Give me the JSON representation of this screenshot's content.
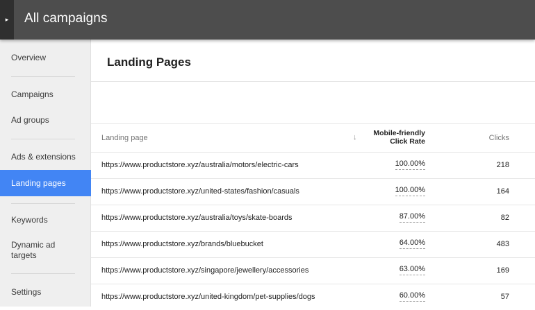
{
  "header": {
    "title": "All campaigns",
    "expand_icon": "▸"
  },
  "sidebar": {
    "items": [
      {
        "label": "Overview"
      },
      {
        "label": "Campaigns"
      },
      {
        "label": "Ad groups"
      },
      {
        "label": "Ads & extensions"
      },
      {
        "label": "Landing pages",
        "active": true
      },
      {
        "label": "Keywords"
      },
      {
        "label": "Dynamic ad targets"
      },
      {
        "label": "Settings"
      }
    ],
    "active_color": "#4285f4"
  },
  "main": {
    "title": "Landing Pages",
    "table": {
      "headers": {
        "landing_page": "Landing page",
        "sort_icon": "↓",
        "rate_line1": "Mobile-friendly",
        "rate_line2": "Click Rate",
        "clicks": "Clicks"
      },
      "rows": [
        {
          "url": "https://www.productstore.xyz/australia/motors/electric-cars",
          "rate": "100.00%",
          "clicks": "218"
        },
        {
          "url": "https://www.productstore.xyz/united-states/fashion/casuals",
          "rate": "100.00%",
          "clicks": "164"
        },
        {
          "url": "https://www.productstore.xyz/australia/toys/skate-boards",
          "rate": "87.00%",
          "clicks": "82"
        },
        {
          "url": "https://www.productstore.xyz/brands/bluebucket",
          "rate": "64.00%",
          "clicks": "483"
        },
        {
          "url": "https://www.productstore.xyz/singapore/jewellery/accessories",
          "rate": "63.00%",
          "clicks": "169"
        },
        {
          "url": "https://www.productstore.xyz/united-kingdom/pet-supplies/dogs",
          "rate": "60.00%",
          "clicks": "57"
        }
      ]
    }
  }
}
